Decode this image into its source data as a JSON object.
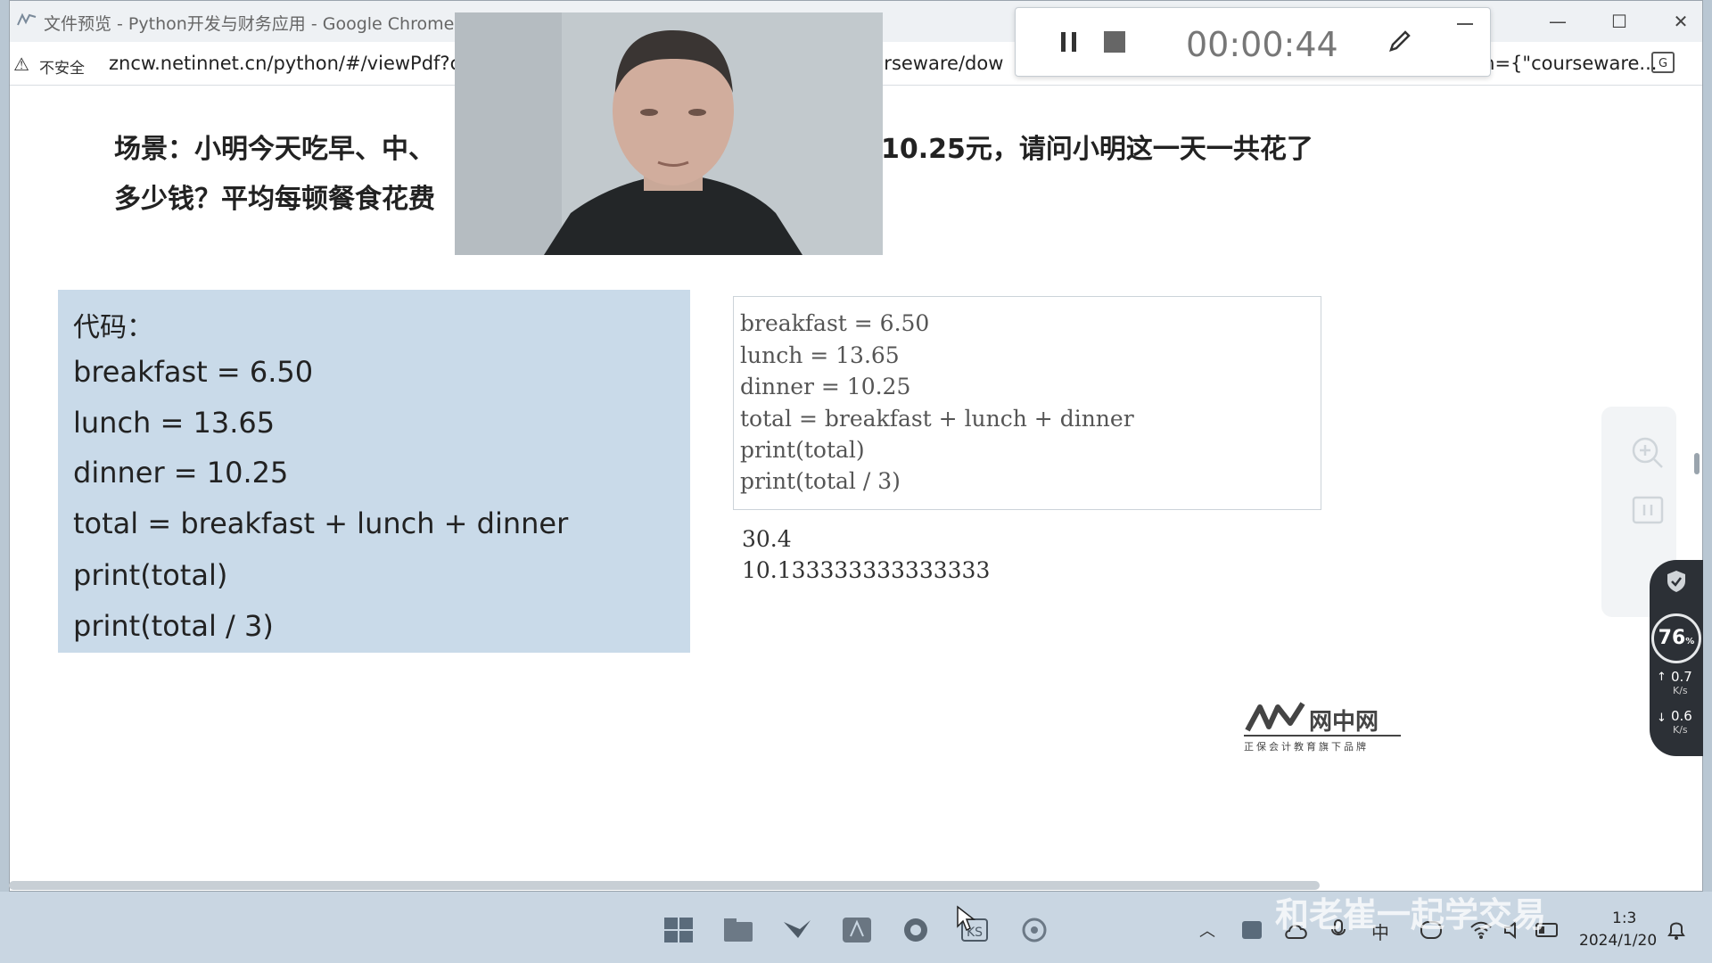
{
  "browser": {
    "title": "文件预览 - Python开发与财务应用 - Google Chrome",
    "insecure_label": "不安全",
    "url_left": "zncw.netinnet.cn/python/#/viewPdf?c",
    "url_mid": "urseware/dow",
    "url_right": "m={\"courseware...",
    "controls": {
      "minimize": "—",
      "maximize": "☐",
      "close": "✕"
    }
  },
  "slide": {
    "scene_line1_a": "场景：小明今天吃早、中、",
    "scene_line1_b": "10.25元，请问小明这一天一共花了",
    "scene_line2": "多少钱？平均每顿餐食花费",
    "code_title": "代码：",
    "code_lines": [
      "breakfast = 6.50",
      "lunch = 13.65",
      "dinner = 10.25",
      "total = breakfast + lunch + dinner",
      "print(total)",
      "print(total /  3)"
    ],
    "notebook_lines": [
      "breakfast = 6.50",
      "lunch = 13.65",
      "dinner = 10.25",
      "total = breakfast + lunch + dinner",
      "print(total)",
      "print(total / 3)"
    ],
    "output_lines": [
      "30.4",
      "10.133333333333333"
    ],
    "brand_name": "网中网",
    "brand_sub": "正保会计教育旗下品牌"
  },
  "recorder": {
    "time": "00:00:44"
  },
  "speed": {
    "percent": "76",
    "percent_unit": "%",
    "up": "0.7",
    "down": "0.6",
    "unit": "K/s"
  },
  "taskbar": {
    "time": "1:3",
    "date": "2024/1/20",
    "watermark": "和老崔一起学交易"
  },
  "colors": {
    "code_panel": "#c9dae9",
    "taskbar": "#c9d6e2"
  }
}
